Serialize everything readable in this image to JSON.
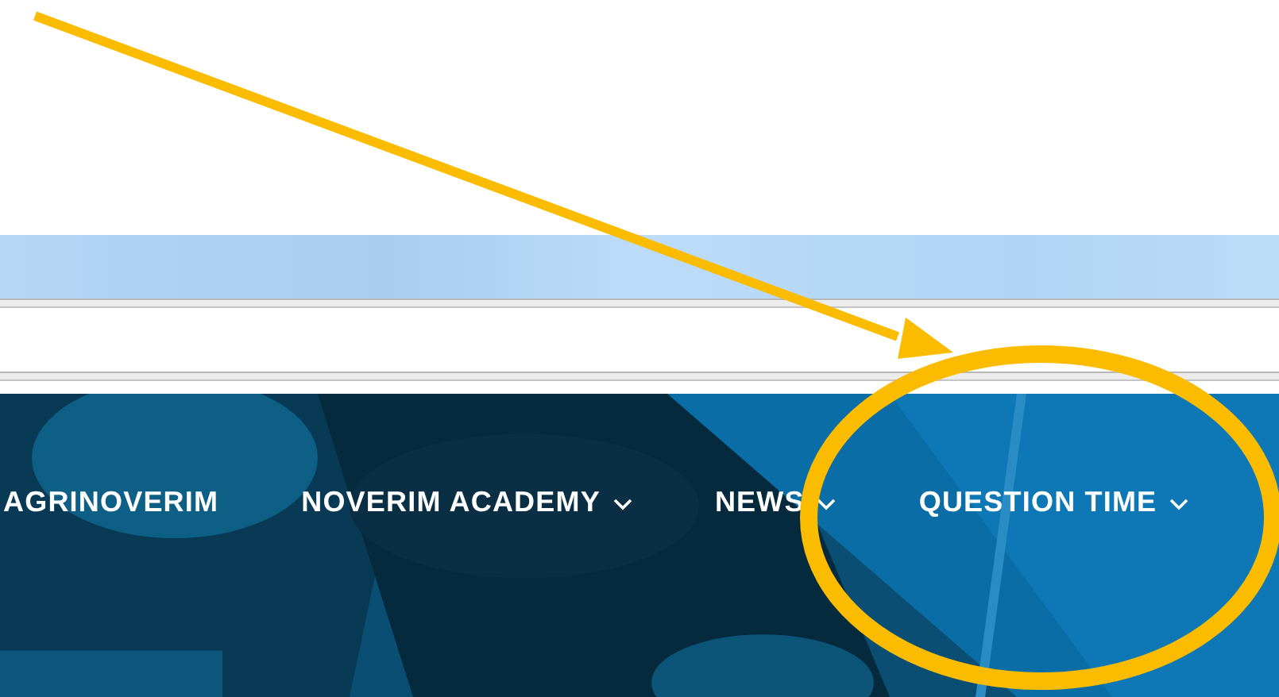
{
  "nav": {
    "items": [
      {
        "label": "AGRINOVERIM",
        "has_menu": false
      },
      {
        "label": "NOVERIM ACADEMY",
        "has_menu": true
      },
      {
        "label": "NEWS",
        "has_menu": true
      },
      {
        "label": "QUESTION TIME",
        "has_menu": true
      }
    ]
  }
}
